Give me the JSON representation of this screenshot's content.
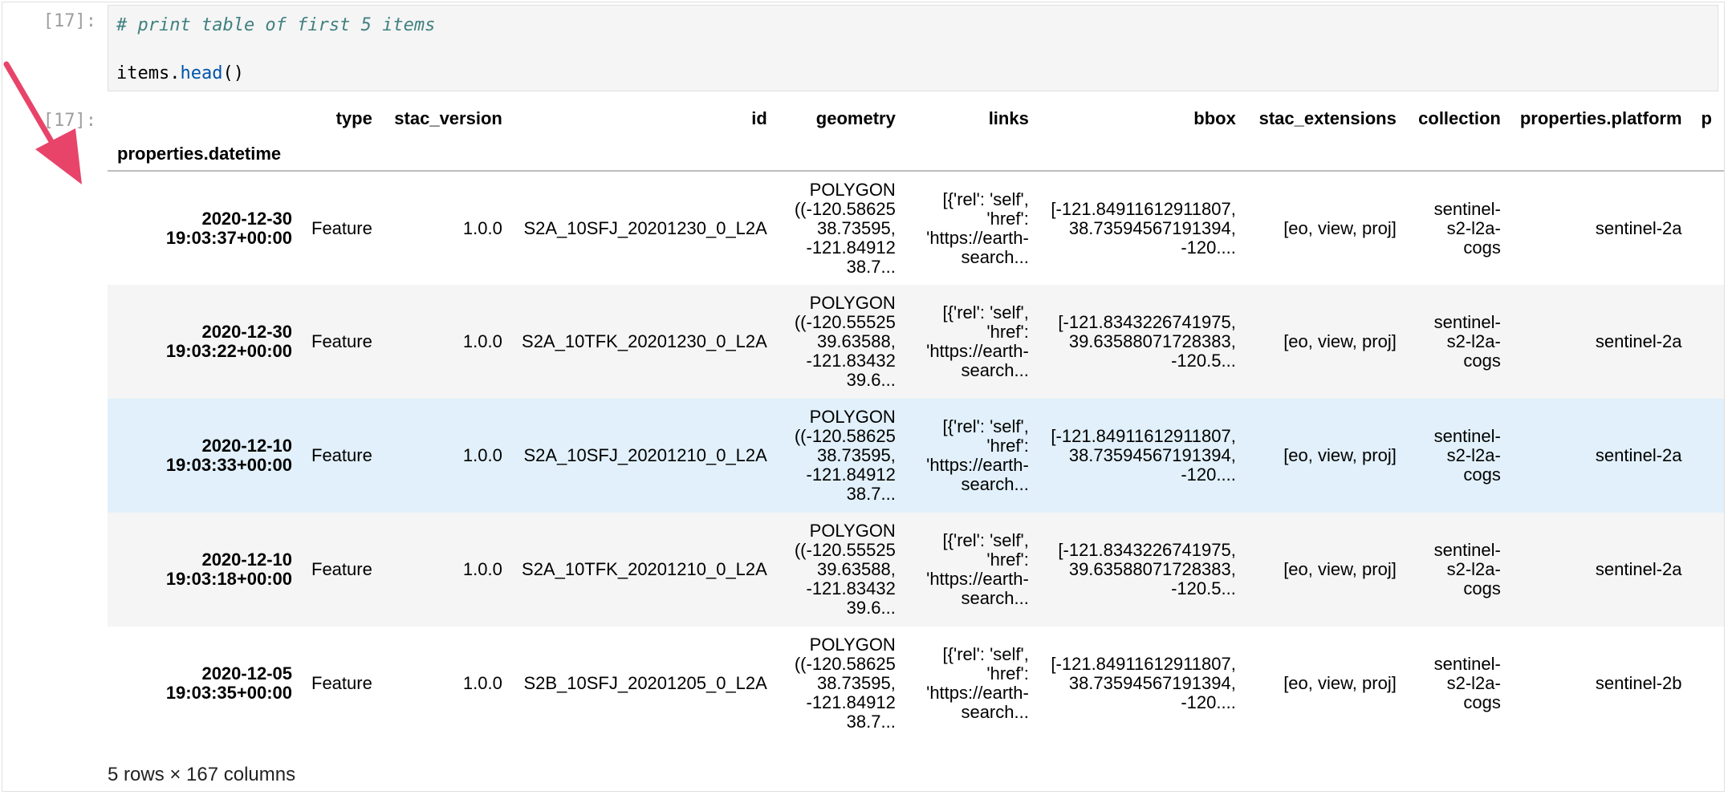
{
  "prompt_in": "[17]:",
  "prompt_out": "[17]:",
  "code": {
    "line1": "# print table of first 5 items",
    "line2_obj": "items.",
    "line2_fn": "head",
    "line2_tail": "()"
  },
  "table": {
    "columns": [
      "type",
      "stac_version",
      "id",
      "geometry",
      "links",
      "bbox",
      "stac_extensions",
      "collection",
      "properties.platform",
      "p"
    ],
    "index_name": "properties.datetime",
    "rows": [
      {
        "index": [
          "2020-12-30",
          "19:03:37+00:00"
        ],
        "type": "Feature",
        "stac_version": "1.0.0",
        "id": "S2A_10SFJ_20201230_0_L2A",
        "geometry": [
          "POLYGON",
          "((-120.58625",
          "38.73595,",
          "-121.84912",
          "38.7..."
        ],
        "links": [
          "[{'rel': 'self',",
          "'href':",
          "'https://earth-",
          "search..."
        ],
        "bbox": [
          "[-121.84911612911807,",
          "38.73594567191394,",
          "-120...."
        ],
        "stac_extensions": "[eo, view, proj]",
        "collection": [
          "sentinel-",
          "s2-l2a-",
          "cogs"
        ],
        "platform": "sentinel-2a"
      },
      {
        "index": [
          "2020-12-30",
          "19:03:22+00:00"
        ],
        "type": "Feature",
        "stac_version": "1.0.0",
        "id": "S2A_10TFK_20201230_0_L2A",
        "geometry": [
          "POLYGON",
          "((-120.55525",
          "39.63588,",
          "-121.83432",
          "39.6..."
        ],
        "links": [
          "[{'rel': 'self',",
          "'href':",
          "'https://earth-",
          "search..."
        ],
        "bbox": [
          "[-121.8343226741975,",
          "39.63588071728383,",
          "-120.5..."
        ],
        "stac_extensions": "[eo, view, proj]",
        "collection": [
          "sentinel-",
          "s2-l2a-",
          "cogs"
        ],
        "platform": "sentinel-2a"
      },
      {
        "index": [
          "2020-12-10",
          "19:03:33+00:00"
        ],
        "type": "Feature",
        "stac_version": "1.0.0",
        "id": "S2A_10SFJ_20201210_0_L2A",
        "geometry": [
          "POLYGON",
          "((-120.58625",
          "38.73595,",
          "-121.84912",
          "38.7..."
        ],
        "links": [
          "[{'rel': 'self',",
          "'href':",
          "'https://earth-",
          "search..."
        ],
        "bbox": [
          "[-121.84911612911807,",
          "38.73594567191394,",
          "-120...."
        ],
        "stac_extensions": "[eo, view, proj]",
        "collection": [
          "sentinel-",
          "s2-l2a-",
          "cogs"
        ],
        "platform": "sentinel-2a"
      },
      {
        "index": [
          "2020-12-10",
          "19:03:18+00:00"
        ],
        "type": "Feature",
        "stac_version": "1.0.0",
        "id": "S2A_10TFK_20201210_0_L2A",
        "geometry": [
          "POLYGON",
          "((-120.55525",
          "39.63588,",
          "-121.83432",
          "39.6..."
        ],
        "links": [
          "[{'rel': 'self',",
          "'href':",
          "'https://earth-",
          "search..."
        ],
        "bbox": [
          "[-121.8343226741975,",
          "39.63588071728383,",
          "-120.5..."
        ],
        "stac_extensions": "[eo, view, proj]",
        "collection": [
          "sentinel-",
          "s2-l2a-",
          "cogs"
        ],
        "platform": "sentinel-2a"
      },
      {
        "index": [
          "2020-12-05",
          "19:03:35+00:00"
        ],
        "type": "Feature",
        "stac_version": "1.0.0",
        "id": "S2B_10SFJ_20201205_0_L2A",
        "geometry": [
          "POLYGON",
          "((-120.58625",
          "38.73595,",
          "-121.84912",
          "38.7..."
        ],
        "links": [
          "[{'rel': 'self',",
          "'href':",
          "'https://earth-",
          "search..."
        ],
        "bbox": [
          "[-121.84911612911807,",
          "38.73594567191394,",
          "-120...."
        ],
        "stac_extensions": "[eo, view, proj]",
        "collection": [
          "sentinel-",
          "s2-l2a-",
          "cogs"
        ],
        "platform": "sentinel-2b"
      }
    ],
    "hover_row": 2
  },
  "row_count_text": "5 rows × 167 columns",
  "colors": {
    "arrow": "#e8446a",
    "hover_row": "#e1f0fa"
  },
  "icons": {
    "annotation": "arrow-icon"
  }
}
